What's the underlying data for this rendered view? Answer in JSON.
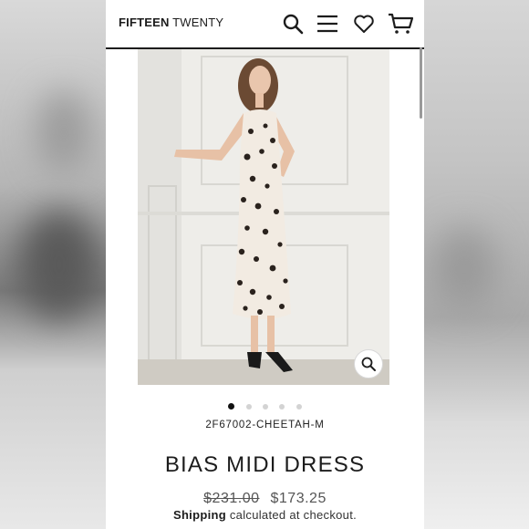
{
  "header": {
    "logo_bold": "FIFTEEN",
    "logo_light": "TWENTY",
    "icons": [
      "search-icon",
      "menu-icon",
      "heart-icon",
      "cart-icon"
    ]
  },
  "gallery": {
    "image_count": 5,
    "active_index": 0,
    "zoom_icon": "zoom-icon"
  },
  "product": {
    "sku": "2F67002-CHEETAH-M",
    "title": "BIAS MIDI DRESS",
    "price_original": "$231.00",
    "price_sale": "$173.25",
    "shipping_bold": "Shipping",
    "shipping_rest": " calculated at checkout."
  },
  "colors": {
    "text": "#1c1c1c",
    "muted": "#555555"
  }
}
